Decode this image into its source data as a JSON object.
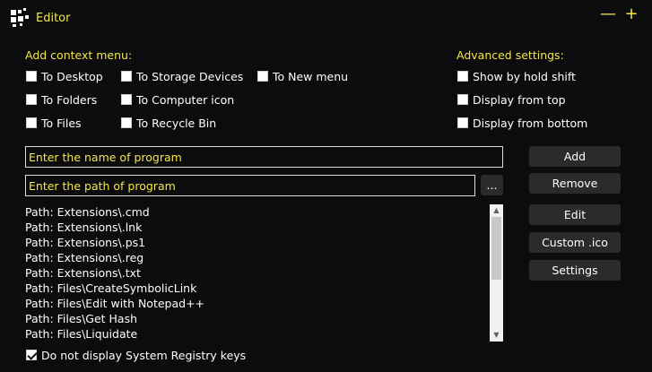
{
  "window": {
    "title": "Editor",
    "minimize_glyph": "—",
    "maximize_glyph": "+"
  },
  "context_menu": {
    "title": "Add context menu:",
    "options": [
      {
        "label": "To Desktop",
        "checked": false
      },
      {
        "label": "To Storage Devices",
        "checked": false
      },
      {
        "label": "To New menu",
        "checked": false
      },
      {
        "label": "To Folders",
        "checked": false
      },
      {
        "label": "To Computer icon",
        "checked": false
      },
      {
        "label": "To Files",
        "checked": false
      },
      {
        "label": "To Recycle Bin",
        "checked": false
      }
    ]
  },
  "advanced": {
    "title": "Advanced settings:",
    "options": [
      {
        "label": "Show by hold shift",
        "checked": false
      },
      {
        "label": "Display from top",
        "checked": false
      },
      {
        "label": "Display from bottom",
        "checked": false
      }
    ]
  },
  "inputs": {
    "name_placeholder": "Enter the name of program",
    "path_placeholder": "Enter the path of program",
    "browse_label": "..."
  },
  "buttons": {
    "add": "Add",
    "remove": "Remove",
    "edit": "Edit",
    "custom_ico": "Custom .ico",
    "settings": "Settings"
  },
  "list": {
    "items": [
      "Path: Extensions\\.cmd",
      "Path: Extensions\\.lnk",
      "Path: Extensions\\.ps1",
      "Path: Extensions\\.reg",
      "Path: Extensions\\.txt",
      "Path: Files\\CreateSymbolicLink",
      "Path: Files\\Edit with Notepad++",
      "Path: Files\\Get Hash",
      "Path: Files\\Liquidate"
    ]
  },
  "footer": {
    "hide_registry_label": "Do not display System Registry keys",
    "hide_registry_checked": true
  },
  "colors": {
    "background": "#0c0b0e",
    "accent": "#f2e84a",
    "button_bg": "#2b2b2d",
    "text": "#ffffff"
  },
  "icons": {
    "app": "app-grid-icon",
    "scroll_up": "scroll-up-arrow-icon",
    "scroll_down": "scroll-down-arrow-icon"
  }
}
